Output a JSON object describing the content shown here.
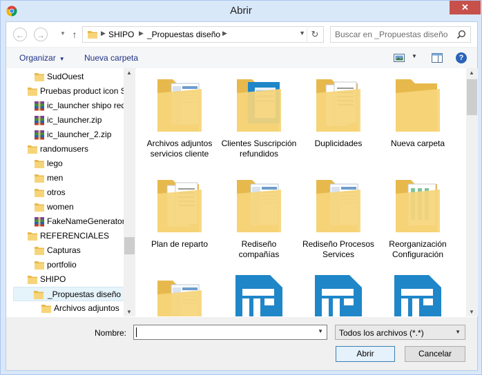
{
  "window": {
    "title": "Abrir",
    "close_glyph": "✕",
    "app_icon": "chrome-icon"
  },
  "nav": {
    "back_glyph": "←",
    "forward_glyph": "→",
    "up_glyph": "↑",
    "path": [
      "SHIPO",
      "_Propuestas diseño"
    ],
    "search_placeholder": "Buscar en _Propuestas diseño"
  },
  "toolbar": {
    "organize_label": "Organizar",
    "new_folder_label": "Nueva carpeta",
    "help_glyph": "?"
  },
  "tree": {
    "items": [
      {
        "label": "SudOuest",
        "icon": "folder-icon"
      },
      {
        "label": "Pruebas product icon S",
        "icon": "folder-icon"
      },
      {
        "label": "ic_launcher shipo redo",
        "icon": "zip-archive-icon"
      },
      {
        "label": "ic_launcher.zip",
        "icon": "zip-archive-icon"
      },
      {
        "label": "ic_launcher_2.zip",
        "icon": "zip-archive-icon"
      },
      {
        "label": "randomusers",
        "icon": "folder-icon"
      },
      {
        "label": "lego",
        "icon": "folder-icon"
      },
      {
        "label": "men",
        "icon": "folder-icon"
      },
      {
        "label": "otros",
        "icon": "folder-icon"
      },
      {
        "label": "women",
        "icon": "folder-icon"
      },
      {
        "label": "FakeNameGenerator",
        "icon": "zip-archive-icon"
      },
      {
        "label": "REFERENCIALES",
        "icon": "folder-icon"
      },
      {
        "label": "Capturas",
        "icon": "folder-icon"
      },
      {
        "label": "portfolio",
        "icon": "folder-icon"
      },
      {
        "label": "SHIPO",
        "icon": "folder-icon"
      },
      {
        "label": "_Propuestas diseño",
        "icon": "folder-icon",
        "selected": true
      },
      {
        "label": "Archivos adjuntos",
        "icon": "folder-icon"
      }
    ]
  },
  "files": [
    {
      "label": "Archivos adjuntos servicios cliente",
      "kind": "folder-screenshots"
    },
    {
      "label": "Clientes Suscripción refundidos",
      "kind": "folder-blue-doc"
    },
    {
      "label": "Duplicidades",
      "kind": "folder-docs"
    },
    {
      "label": "Nueva carpeta",
      "kind": "folder-plain"
    },
    {
      "label": "Plan de reparto",
      "kind": "folder-docs"
    },
    {
      "label": "Rediseño compañías",
      "kind": "folder-screenshots"
    },
    {
      "label": "Rediseño Procesos Services",
      "kind": "folder-screenshots"
    },
    {
      "label": "Reorganización Configuración",
      "kind": "folder-green-sheets"
    },
    {
      "label": "",
      "kind": "folder-screenshots"
    },
    {
      "label": "",
      "kind": "blue-app-file"
    },
    {
      "label": "",
      "kind": "blue-app-file"
    },
    {
      "label": "",
      "kind": "blue-app-file"
    }
  ],
  "footer": {
    "name_label": "Nombre:",
    "name_value": "",
    "file_type": "Todos los archivos (*.*)",
    "open_label": "Abrir",
    "cancel_label": "Cancelar"
  },
  "colors": {
    "folder": "#f3d271",
    "accent_blue": "#1f86c8",
    "selection": "#e5f3fb"
  }
}
